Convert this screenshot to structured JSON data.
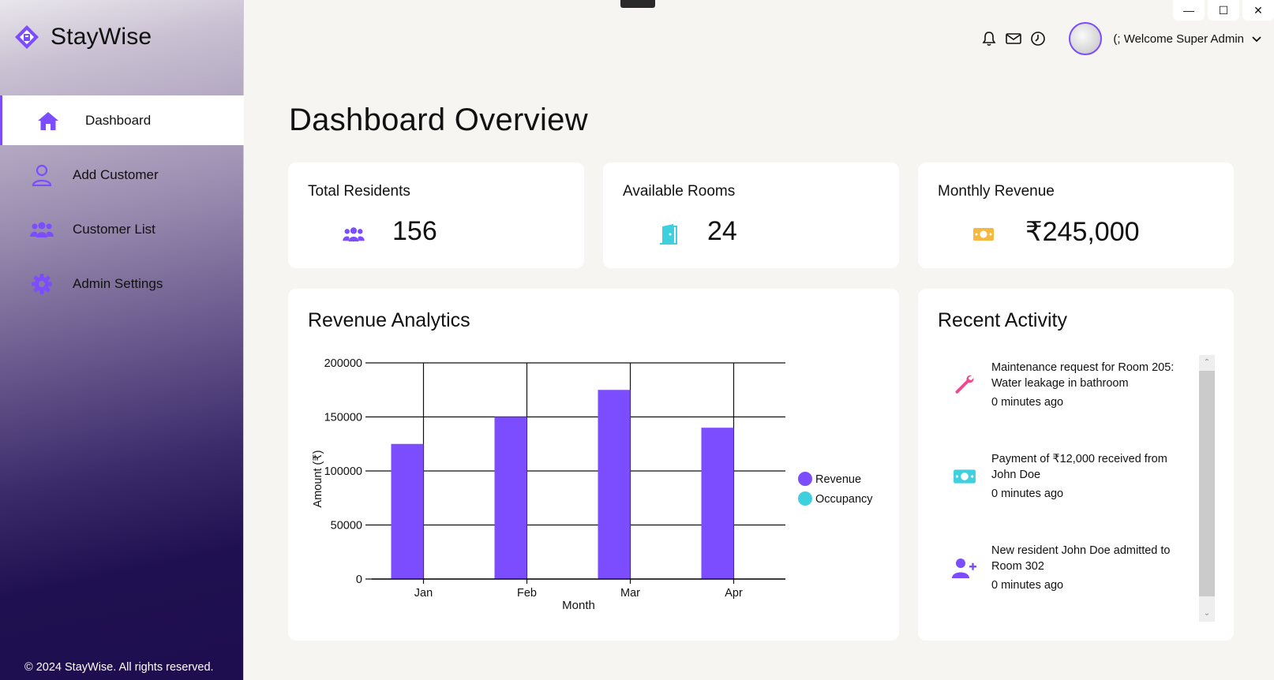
{
  "app": {
    "name": "StayWise"
  },
  "sidebar": {
    "items": [
      {
        "label": "Dashboard",
        "icon": "home-icon",
        "active": true
      },
      {
        "label": "Add Customer",
        "icon": "user-icon",
        "active": false
      },
      {
        "label": "Customer List",
        "icon": "users-icon",
        "active": false
      },
      {
        "label": "Admin Settings",
        "icon": "gear-icon",
        "active": false
      }
    ],
    "footer": "© 2024 StayWise. All rights reserved."
  },
  "header": {
    "welcome": "(; Welcome Super Admin",
    "icons": [
      "bell-icon",
      "mail-icon",
      "clock-icon"
    ]
  },
  "window_controls": {
    "minimize": "—",
    "maximize": "☐",
    "close": "✕"
  },
  "page": {
    "title": "Dashboard Overview"
  },
  "stats": [
    {
      "title": "Total Residents",
      "value": "156",
      "icon": "users-icon",
      "color": "#7c4dff"
    },
    {
      "title": "Available Rooms",
      "value": "24",
      "icon": "door-icon",
      "color": "#3fd0e0"
    },
    {
      "title": "Monthly Revenue",
      "value": "₹245,000",
      "icon": "money-icon",
      "color": "#f5b942"
    }
  ],
  "revenue": {
    "title": "Revenue Analytics"
  },
  "chart_data": {
    "type": "bar",
    "categories": [
      "Jan",
      "Feb",
      "Mar",
      "Apr"
    ],
    "series": [
      {
        "name": "Revenue",
        "values": [
          125000,
          150000,
          175000,
          140000
        ],
        "color": "#7c4dff"
      },
      {
        "name": "Occupancy",
        "values": [
          0,
          0,
          0,
          0
        ],
        "color": "#3fd0e0"
      }
    ],
    "xlabel": "Month",
    "ylabel": "Amount (₹)",
    "ylim": [
      0,
      200000
    ],
    "yticks": [
      "0",
      "50000",
      "100000",
      "150000",
      "200000"
    ],
    "grid": true,
    "legend": "right"
  },
  "activity": {
    "title": "Recent Activity",
    "items": [
      {
        "text": "Maintenance request for Room 205: Water leakage in bathroom",
        "time": "0 minutes ago",
        "icon": "wrench-icon",
        "color": "#ec4b8f"
      },
      {
        "text": "Payment of ₹12,000 received from John Doe",
        "time": "0 minutes ago",
        "icon": "money-icon",
        "color": "#3fd0e0"
      },
      {
        "text": "New resident John Doe admitted to Room 302",
        "time": "0 minutes ago",
        "icon": "user-plus-icon",
        "color": "#7c4dff"
      }
    ]
  }
}
